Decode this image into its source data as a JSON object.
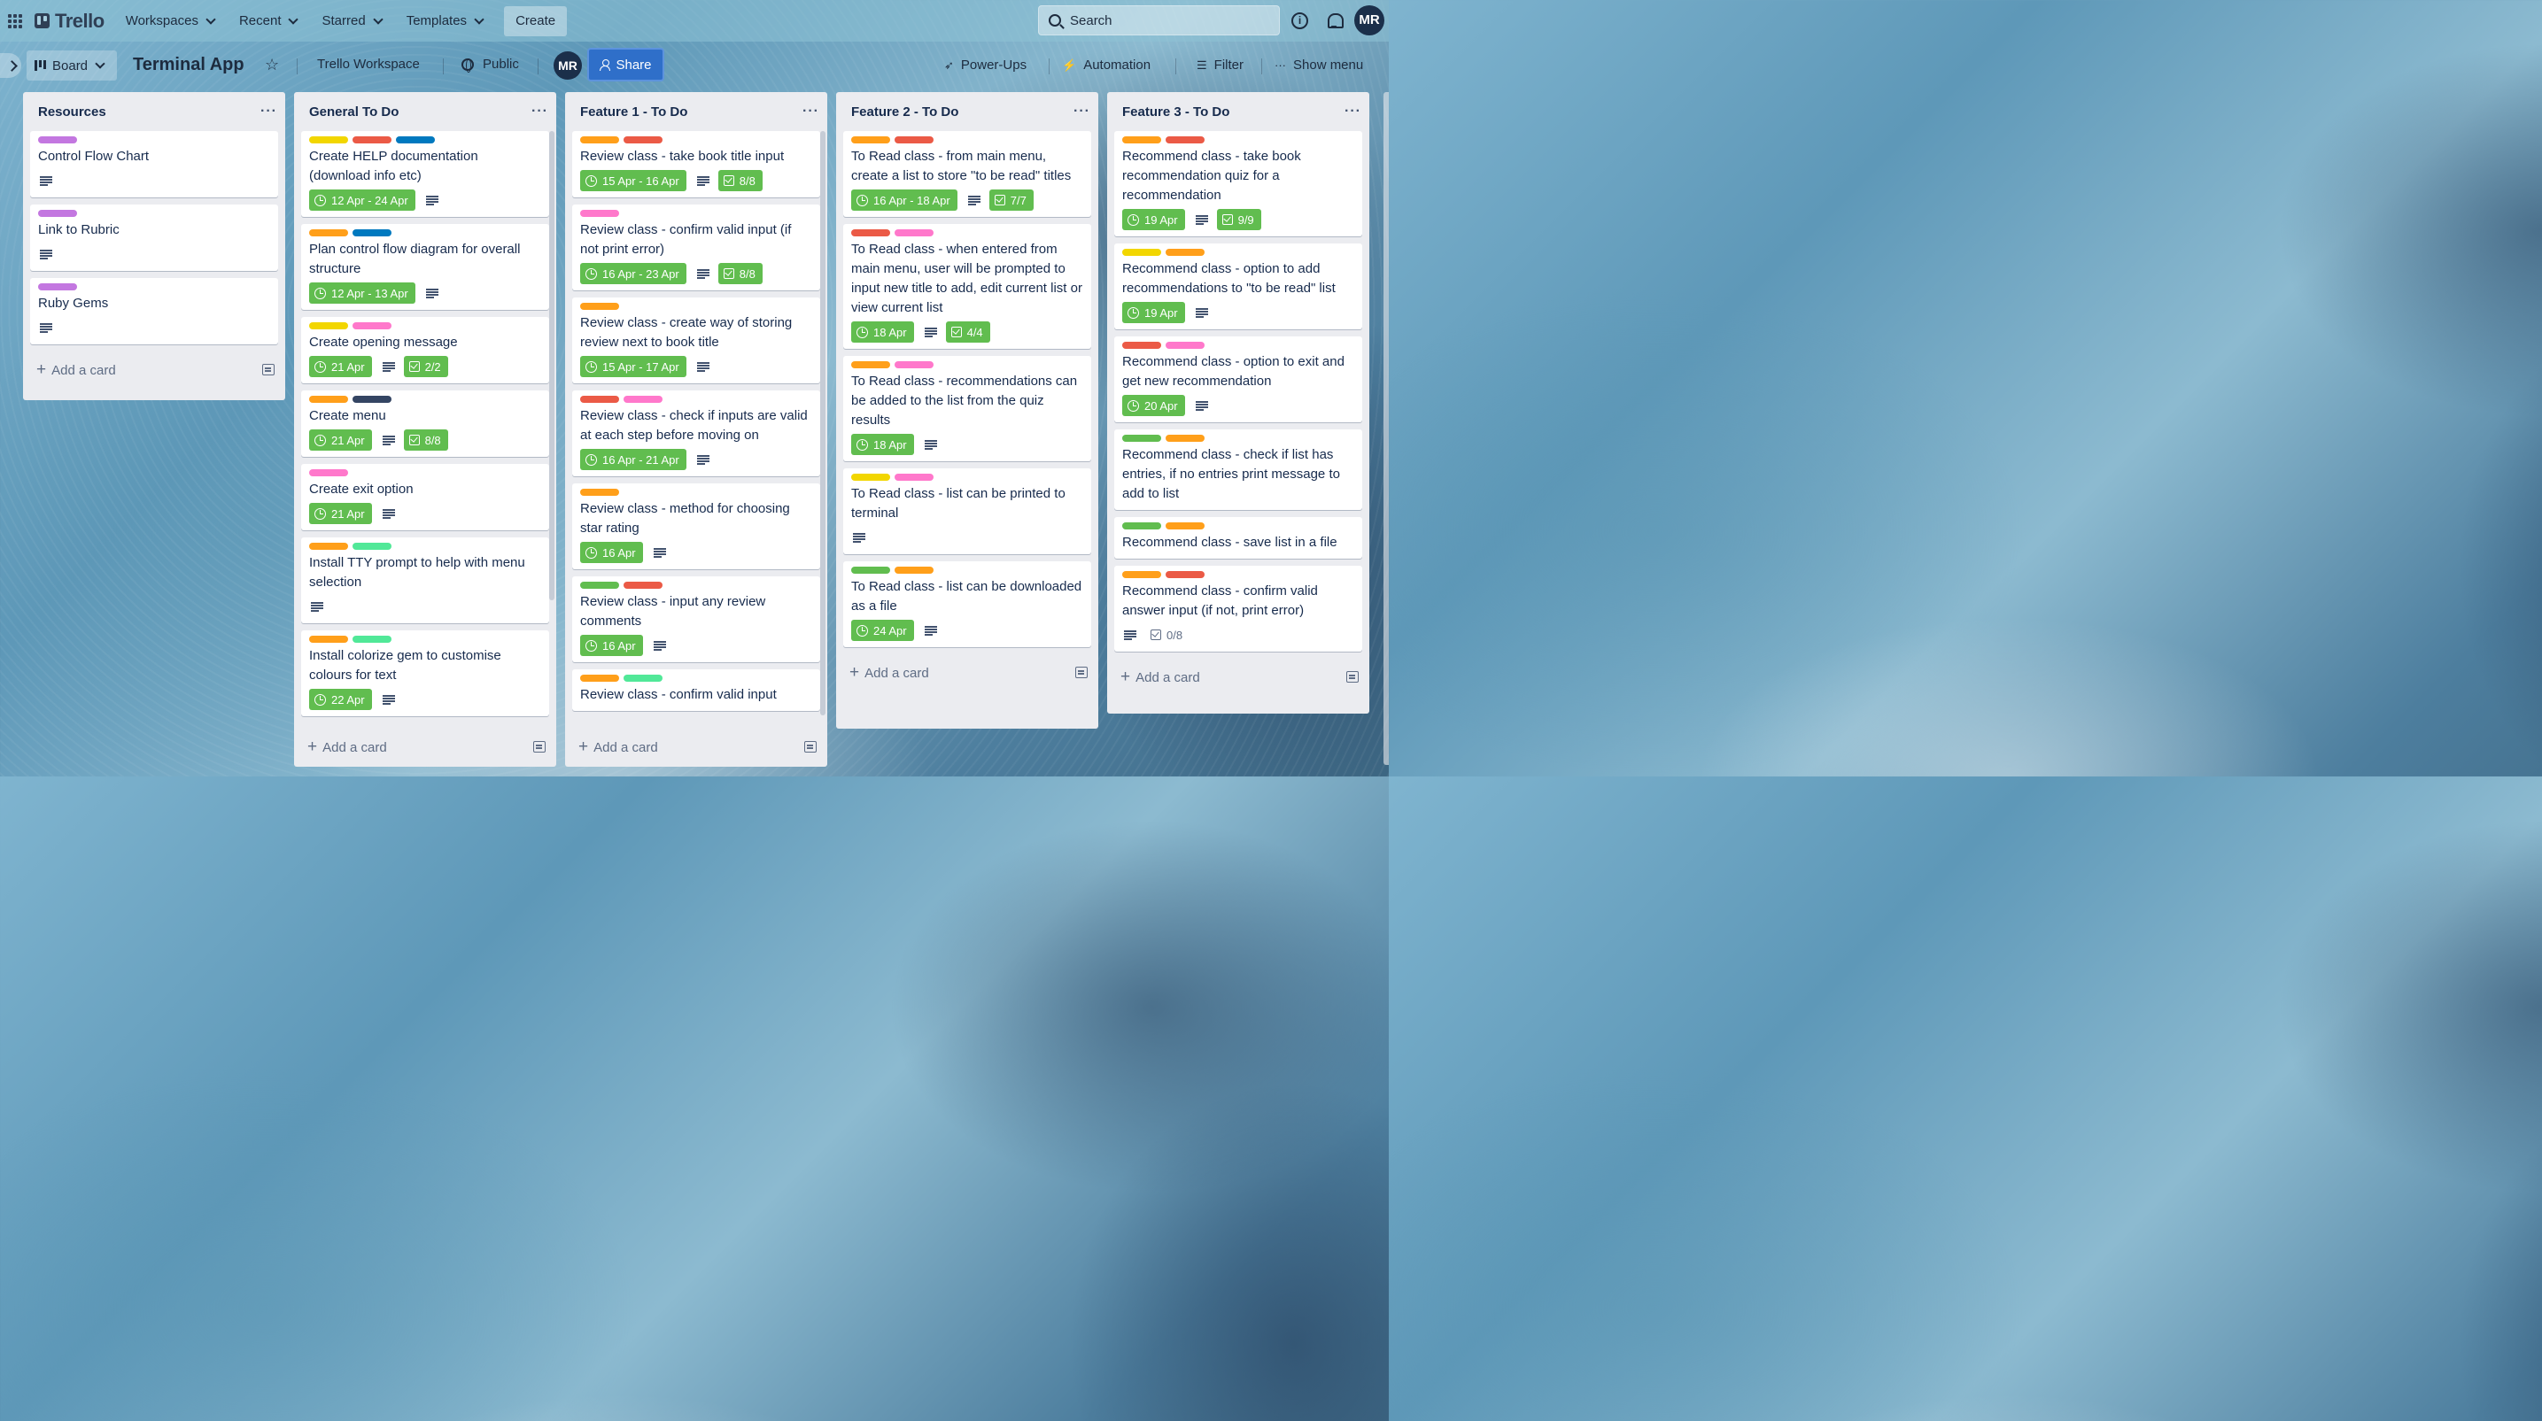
{
  "nav": {
    "logo": "Trello",
    "menu": [
      "Workspaces",
      "Recent",
      "Starred",
      "Templates"
    ],
    "create": "Create",
    "search_placeholder": "Search",
    "avatar": "MR"
  },
  "board": {
    "view": "Board",
    "title": "Terminal App",
    "workspace": "Trello Workspace",
    "visibility": "Public",
    "member": "MR",
    "share": "Share",
    "powerups": "Power-Ups",
    "automation": "Automation",
    "filter": "Filter",
    "show_menu": "Show menu"
  },
  "label_colors": {
    "green": "#61bd4f",
    "yellow": "#f2d600",
    "orange": "#ff9f1a",
    "red": "#eb5a46",
    "purple": "#c377e0",
    "blue": "#0079bf",
    "pink": "#ff78cb",
    "lime": "#51e898",
    "navy": "#344563"
  },
  "lists": [
    {
      "title": "Resources",
      "add_card": "Add a card",
      "cards": [
        {
          "labels": [
            "purple"
          ],
          "text": "Control Flow Chart",
          "date": "",
          "checklist": "",
          "desc": true
        },
        {
          "labels": [
            "purple"
          ],
          "text": "Link to Rubric",
          "date": "",
          "checklist": "",
          "desc": true
        },
        {
          "labels": [
            "purple"
          ],
          "text": "Ruby Gems",
          "date": "",
          "checklist": "",
          "desc": true
        }
      ]
    },
    {
      "title": "General To Do",
      "add_card": "Add a card",
      "cards": [
        {
          "labels": [
            "yellow",
            "red",
            "blue"
          ],
          "text": "Create HELP documentation (download info etc)",
          "date": "12 Apr - 24 Apr",
          "checklist": "",
          "desc": true
        },
        {
          "labels": [
            "orange",
            "blue"
          ],
          "text": "Plan control flow diagram for overall structure",
          "date": "12 Apr - 13 Apr",
          "checklist": "",
          "desc": true
        },
        {
          "labels": [
            "yellow",
            "pink"
          ],
          "text": "Create opening message",
          "date": "21 Apr",
          "checklist": "2/2",
          "desc": true
        },
        {
          "labels": [
            "orange",
            "navy"
          ],
          "text": "Create menu",
          "date": "21 Apr",
          "checklist": "8/8",
          "desc": true
        },
        {
          "labels": [
            "pink"
          ],
          "text": "Create exit option",
          "date": "21 Apr",
          "checklist": "",
          "desc": true
        },
        {
          "labels": [
            "orange",
            "lime"
          ],
          "text": "Install TTY prompt to help with menu selection",
          "date": "",
          "checklist": "",
          "desc": true
        },
        {
          "labels": [
            "orange",
            "lime"
          ],
          "text": "Install colorize gem to customise colours for text",
          "date": "22 Apr",
          "checklist": "",
          "desc": true
        }
      ]
    },
    {
      "title": "Feature 1 - To Do",
      "add_card": "Add a card",
      "cards": [
        {
          "labels": [
            "orange",
            "red"
          ],
          "text": "Review class - take book title input",
          "date": "15 Apr - 16 Apr",
          "checklist": "8/8",
          "desc": true
        },
        {
          "labels": [
            "pink"
          ],
          "text": "Review class - confirm valid input (if not print error)",
          "date": "16 Apr - 23 Apr",
          "checklist": "8/8",
          "desc": true
        },
        {
          "labels": [
            "orange"
          ],
          "text": "Review class - create way of storing review next to book title",
          "date": "15 Apr - 17 Apr",
          "checklist": "",
          "desc": true
        },
        {
          "labels": [
            "red",
            "pink"
          ],
          "text": "Review class - check if inputs are valid at each step before moving on",
          "date": "16 Apr - 21 Apr",
          "checklist": "",
          "desc": true
        },
        {
          "labels": [
            "orange"
          ],
          "text": "Review class - method for choosing star rating",
          "date": "16 Apr",
          "checklist": "",
          "desc": true
        },
        {
          "labels": [
            "green",
            "red"
          ],
          "text": "Review class - input any review comments",
          "date": "16 Apr",
          "checklist": "",
          "desc": true
        },
        {
          "labels": [
            "orange",
            "lime"
          ],
          "text": "Review class - confirm valid input",
          "date": "",
          "checklist": "",
          "desc": false
        }
      ]
    },
    {
      "title": "Feature 2 - To Do",
      "add_card": "Add a card",
      "cards": [
        {
          "labels": [
            "orange",
            "red"
          ],
          "text": "To Read class - from main menu, create a list to store \"to be read\" titles",
          "date": "16 Apr - 18 Apr",
          "checklist": "7/7",
          "desc": true
        },
        {
          "labels": [
            "red",
            "pink"
          ],
          "text": "To Read class - when entered from main menu, user will be prompted to input new title to add, edit current list or view current list",
          "date": "18 Apr",
          "checklist": "4/4",
          "desc": true
        },
        {
          "labels": [
            "orange",
            "pink"
          ],
          "text": "To Read class - recommendations can be added to the list from the quiz results",
          "date": "18 Apr",
          "checklist": "",
          "desc": true
        },
        {
          "labels": [
            "yellow",
            "pink"
          ],
          "text": "To Read class - list can be printed to terminal",
          "date": "",
          "checklist": "",
          "desc": true
        },
        {
          "labels": [
            "green",
            "orange"
          ],
          "text": "To Read class - list can be downloaded as a file",
          "date": "24 Apr",
          "checklist": "",
          "desc": true
        }
      ]
    },
    {
      "title": "Feature 3 - To Do",
      "add_card": "Add a card",
      "cards": [
        {
          "labels": [
            "orange",
            "red"
          ],
          "text": "Recommend class - take book recommendation quiz for a recommendation",
          "date": "19 Apr",
          "checklist": "9/9",
          "desc": true
        },
        {
          "labels": [
            "yellow",
            "orange"
          ],
          "text": "Recommend class - option to add recommendations to \"to be read\" list",
          "date": "19 Apr",
          "checklist": "",
          "desc": true
        },
        {
          "labels": [
            "red",
            "pink"
          ],
          "text": "Recommend class - option to exit and get new recommendation",
          "date": "20 Apr",
          "checklist": "",
          "desc": true
        },
        {
          "labels": [
            "green",
            "orange"
          ],
          "text": "Recommend class - check if list has entries, if no entries print message to add to list",
          "date": "",
          "checklist": "",
          "desc": false
        },
        {
          "labels": [
            "green",
            "orange"
          ],
          "text": "Recommend class - save list in a file",
          "date": "",
          "checklist": "",
          "desc": false
        },
        {
          "labels": [
            "orange",
            "red"
          ],
          "text": "Recommend class - confirm valid answer input (if not, print error)",
          "date": "",
          "checklist": "0/8",
          "desc": true
        }
      ]
    }
  ]
}
